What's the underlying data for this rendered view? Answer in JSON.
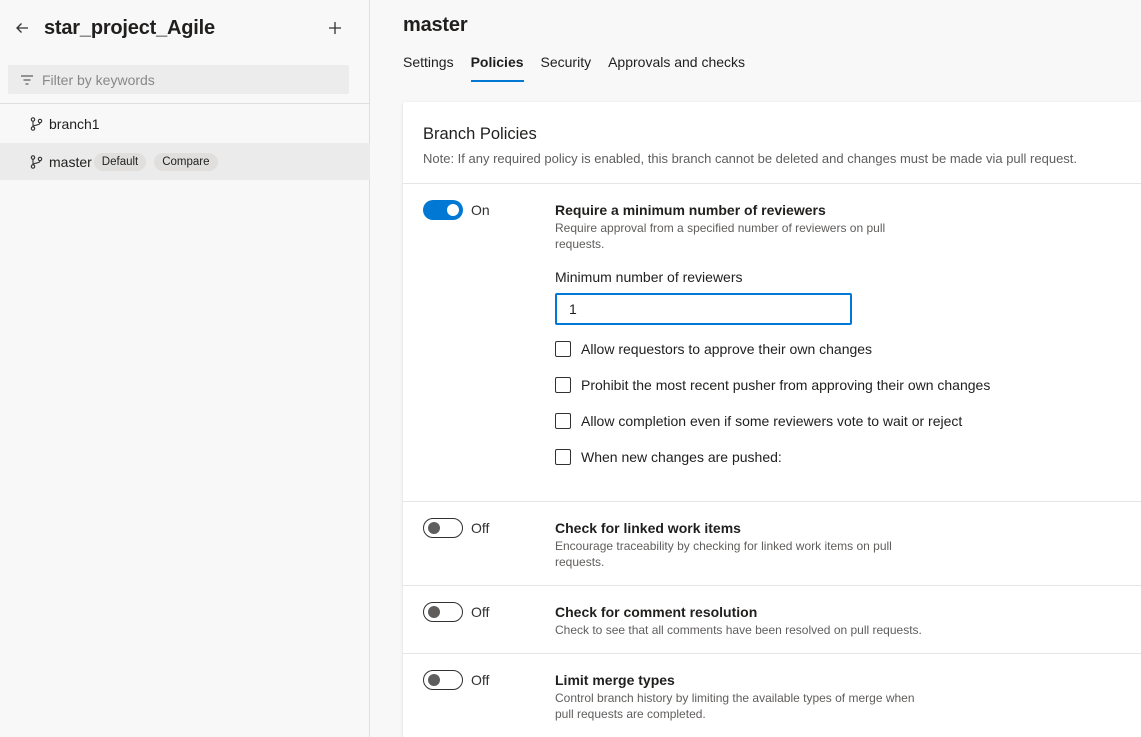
{
  "sidebar": {
    "project_title": "star_project_Agile",
    "filter_placeholder": "Filter by keywords",
    "branches": [
      {
        "name": "branch1",
        "badges": []
      },
      {
        "name": "master",
        "badges": [
          "Default",
          "Compare"
        ],
        "selected": true
      }
    ]
  },
  "main": {
    "title": "master",
    "tabs": [
      {
        "label": "Settings"
      },
      {
        "label": "Policies",
        "active": true
      },
      {
        "label": "Security"
      },
      {
        "label": "Approvals and checks"
      }
    ],
    "card": {
      "title": "Branch Policies",
      "note": "Note: If any required policy is enabled, this branch cannot be deleted and changes must be made via pull request.",
      "policies": [
        {
          "toggle": "On",
          "title": "Require a minimum number of reviewers",
          "description": "Require approval from a specified number of reviewers on pull requests.",
          "field_label": "Minimum number of reviewers",
          "field_value": "1",
          "options": [
            "Allow requestors to approve their own changes",
            "Prohibit the most recent pusher from approving their own changes",
            "Allow completion even if some reviewers vote to wait or reject",
            "When new changes are pushed:"
          ]
        },
        {
          "toggle": "Off",
          "title": "Check for linked work items",
          "description": "Encourage traceability by checking for linked work items on pull requests."
        },
        {
          "toggle": "Off",
          "title": "Check for comment resolution",
          "description": "Check to see that all comments have been resolved on pull requests."
        },
        {
          "toggle": "Off",
          "title": "Limit merge types",
          "description": "Control branch history by limiting the available types of merge when pull requests are completed."
        }
      ]
    }
  },
  "colors": {
    "accent": "#0078d4",
    "sidebar_selected": "#ebebeb",
    "badge_bg": "#e1dfdd"
  },
  "icons": {
    "back": "arrow-left-icon",
    "add": "plus-icon",
    "filter": "filter-icon",
    "branch": "git-branch-icon"
  }
}
